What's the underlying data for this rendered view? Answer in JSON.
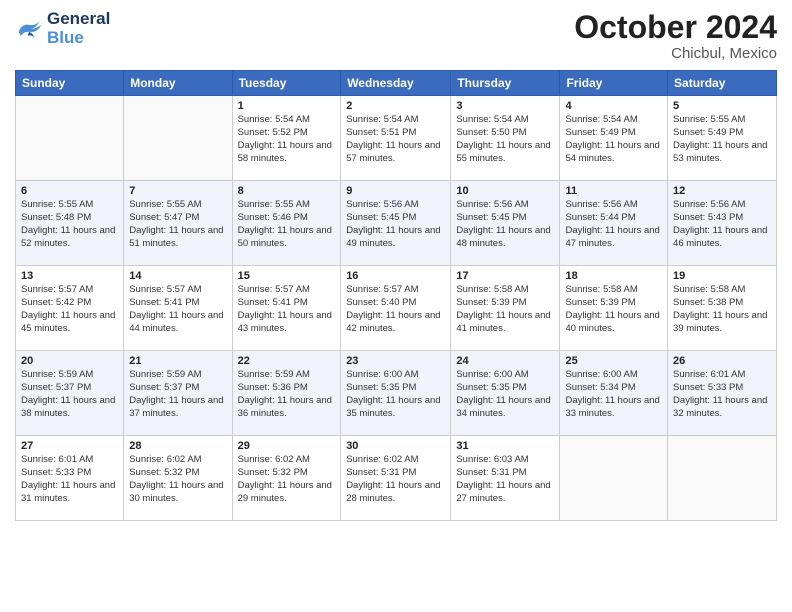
{
  "header": {
    "logo_general": "General",
    "logo_blue": "Blue",
    "month_title": "October 2024",
    "location": "Chicbul, Mexico"
  },
  "weekdays": [
    "Sunday",
    "Monday",
    "Tuesday",
    "Wednesday",
    "Thursday",
    "Friday",
    "Saturday"
  ],
  "weeks": [
    [
      {
        "day": "",
        "sunrise": "",
        "sunset": "",
        "daylight": ""
      },
      {
        "day": "",
        "sunrise": "",
        "sunset": "",
        "daylight": ""
      },
      {
        "day": "1",
        "sunrise": "Sunrise: 5:54 AM",
        "sunset": "Sunset: 5:52 PM",
        "daylight": "Daylight: 11 hours and 58 minutes."
      },
      {
        "day": "2",
        "sunrise": "Sunrise: 5:54 AM",
        "sunset": "Sunset: 5:51 PM",
        "daylight": "Daylight: 11 hours and 57 minutes."
      },
      {
        "day": "3",
        "sunrise": "Sunrise: 5:54 AM",
        "sunset": "Sunset: 5:50 PM",
        "daylight": "Daylight: 11 hours and 55 minutes."
      },
      {
        "day": "4",
        "sunrise": "Sunrise: 5:54 AM",
        "sunset": "Sunset: 5:49 PM",
        "daylight": "Daylight: 11 hours and 54 minutes."
      },
      {
        "day": "5",
        "sunrise": "Sunrise: 5:55 AM",
        "sunset": "Sunset: 5:49 PM",
        "daylight": "Daylight: 11 hours and 53 minutes."
      }
    ],
    [
      {
        "day": "6",
        "sunrise": "Sunrise: 5:55 AM",
        "sunset": "Sunset: 5:48 PM",
        "daylight": "Daylight: 11 hours and 52 minutes."
      },
      {
        "day": "7",
        "sunrise": "Sunrise: 5:55 AM",
        "sunset": "Sunset: 5:47 PM",
        "daylight": "Daylight: 11 hours and 51 minutes."
      },
      {
        "day": "8",
        "sunrise": "Sunrise: 5:55 AM",
        "sunset": "Sunset: 5:46 PM",
        "daylight": "Daylight: 11 hours and 50 minutes."
      },
      {
        "day": "9",
        "sunrise": "Sunrise: 5:56 AM",
        "sunset": "Sunset: 5:45 PM",
        "daylight": "Daylight: 11 hours and 49 minutes."
      },
      {
        "day": "10",
        "sunrise": "Sunrise: 5:56 AM",
        "sunset": "Sunset: 5:45 PM",
        "daylight": "Daylight: 11 hours and 48 minutes."
      },
      {
        "day": "11",
        "sunrise": "Sunrise: 5:56 AM",
        "sunset": "Sunset: 5:44 PM",
        "daylight": "Daylight: 11 hours and 47 minutes."
      },
      {
        "day": "12",
        "sunrise": "Sunrise: 5:56 AM",
        "sunset": "Sunset: 5:43 PM",
        "daylight": "Daylight: 11 hours and 46 minutes."
      }
    ],
    [
      {
        "day": "13",
        "sunrise": "Sunrise: 5:57 AM",
        "sunset": "Sunset: 5:42 PM",
        "daylight": "Daylight: 11 hours and 45 minutes."
      },
      {
        "day": "14",
        "sunrise": "Sunrise: 5:57 AM",
        "sunset": "Sunset: 5:41 PM",
        "daylight": "Daylight: 11 hours and 44 minutes."
      },
      {
        "day": "15",
        "sunrise": "Sunrise: 5:57 AM",
        "sunset": "Sunset: 5:41 PM",
        "daylight": "Daylight: 11 hours and 43 minutes."
      },
      {
        "day": "16",
        "sunrise": "Sunrise: 5:57 AM",
        "sunset": "Sunset: 5:40 PM",
        "daylight": "Daylight: 11 hours and 42 minutes."
      },
      {
        "day": "17",
        "sunrise": "Sunrise: 5:58 AM",
        "sunset": "Sunset: 5:39 PM",
        "daylight": "Daylight: 11 hours and 41 minutes."
      },
      {
        "day": "18",
        "sunrise": "Sunrise: 5:58 AM",
        "sunset": "Sunset: 5:39 PM",
        "daylight": "Daylight: 11 hours and 40 minutes."
      },
      {
        "day": "19",
        "sunrise": "Sunrise: 5:58 AM",
        "sunset": "Sunset: 5:38 PM",
        "daylight": "Daylight: 11 hours and 39 minutes."
      }
    ],
    [
      {
        "day": "20",
        "sunrise": "Sunrise: 5:59 AM",
        "sunset": "Sunset: 5:37 PM",
        "daylight": "Daylight: 11 hours and 38 minutes."
      },
      {
        "day": "21",
        "sunrise": "Sunrise: 5:59 AM",
        "sunset": "Sunset: 5:37 PM",
        "daylight": "Daylight: 11 hours and 37 minutes."
      },
      {
        "day": "22",
        "sunrise": "Sunrise: 5:59 AM",
        "sunset": "Sunset: 5:36 PM",
        "daylight": "Daylight: 11 hours and 36 minutes."
      },
      {
        "day": "23",
        "sunrise": "Sunrise: 6:00 AM",
        "sunset": "Sunset: 5:35 PM",
        "daylight": "Daylight: 11 hours and 35 minutes."
      },
      {
        "day": "24",
        "sunrise": "Sunrise: 6:00 AM",
        "sunset": "Sunset: 5:35 PM",
        "daylight": "Daylight: 11 hours and 34 minutes."
      },
      {
        "day": "25",
        "sunrise": "Sunrise: 6:00 AM",
        "sunset": "Sunset: 5:34 PM",
        "daylight": "Daylight: 11 hours and 33 minutes."
      },
      {
        "day": "26",
        "sunrise": "Sunrise: 6:01 AM",
        "sunset": "Sunset: 5:33 PM",
        "daylight": "Daylight: 11 hours and 32 minutes."
      }
    ],
    [
      {
        "day": "27",
        "sunrise": "Sunrise: 6:01 AM",
        "sunset": "Sunset: 5:33 PM",
        "daylight": "Daylight: 11 hours and 31 minutes."
      },
      {
        "day": "28",
        "sunrise": "Sunrise: 6:02 AM",
        "sunset": "Sunset: 5:32 PM",
        "daylight": "Daylight: 11 hours and 30 minutes."
      },
      {
        "day": "29",
        "sunrise": "Sunrise: 6:02 AM",
        "sunset": "Sunset: 5:32 PM",
        "daylight": "Daylight: 11 hours and 29 minutes."
      },
      {
        "day": "30",
        "sunrise": "Sunrise: 6:02 AM",
        "sunset": "Sunset: 5:31 PM",
        "daylight": "Daylight: 11 hours and 28 minutes."
      },
      {
        "day": "31",
        "sunrise": "Sunrise: 6:03 AM",
        "sunset": "Sunset: 5:31 PM",
        "daylight": "Daylight: 11 hours and 27 minutes."
      },
      {
        "day": "",
        "sunrise": "",
        "sunset": "",
        "daylight": ""
      },
      {
        "day": "",
        "sunrise": "",
        "sunset": "",
        "daylight": ""
      }
    ]
  ]
}
